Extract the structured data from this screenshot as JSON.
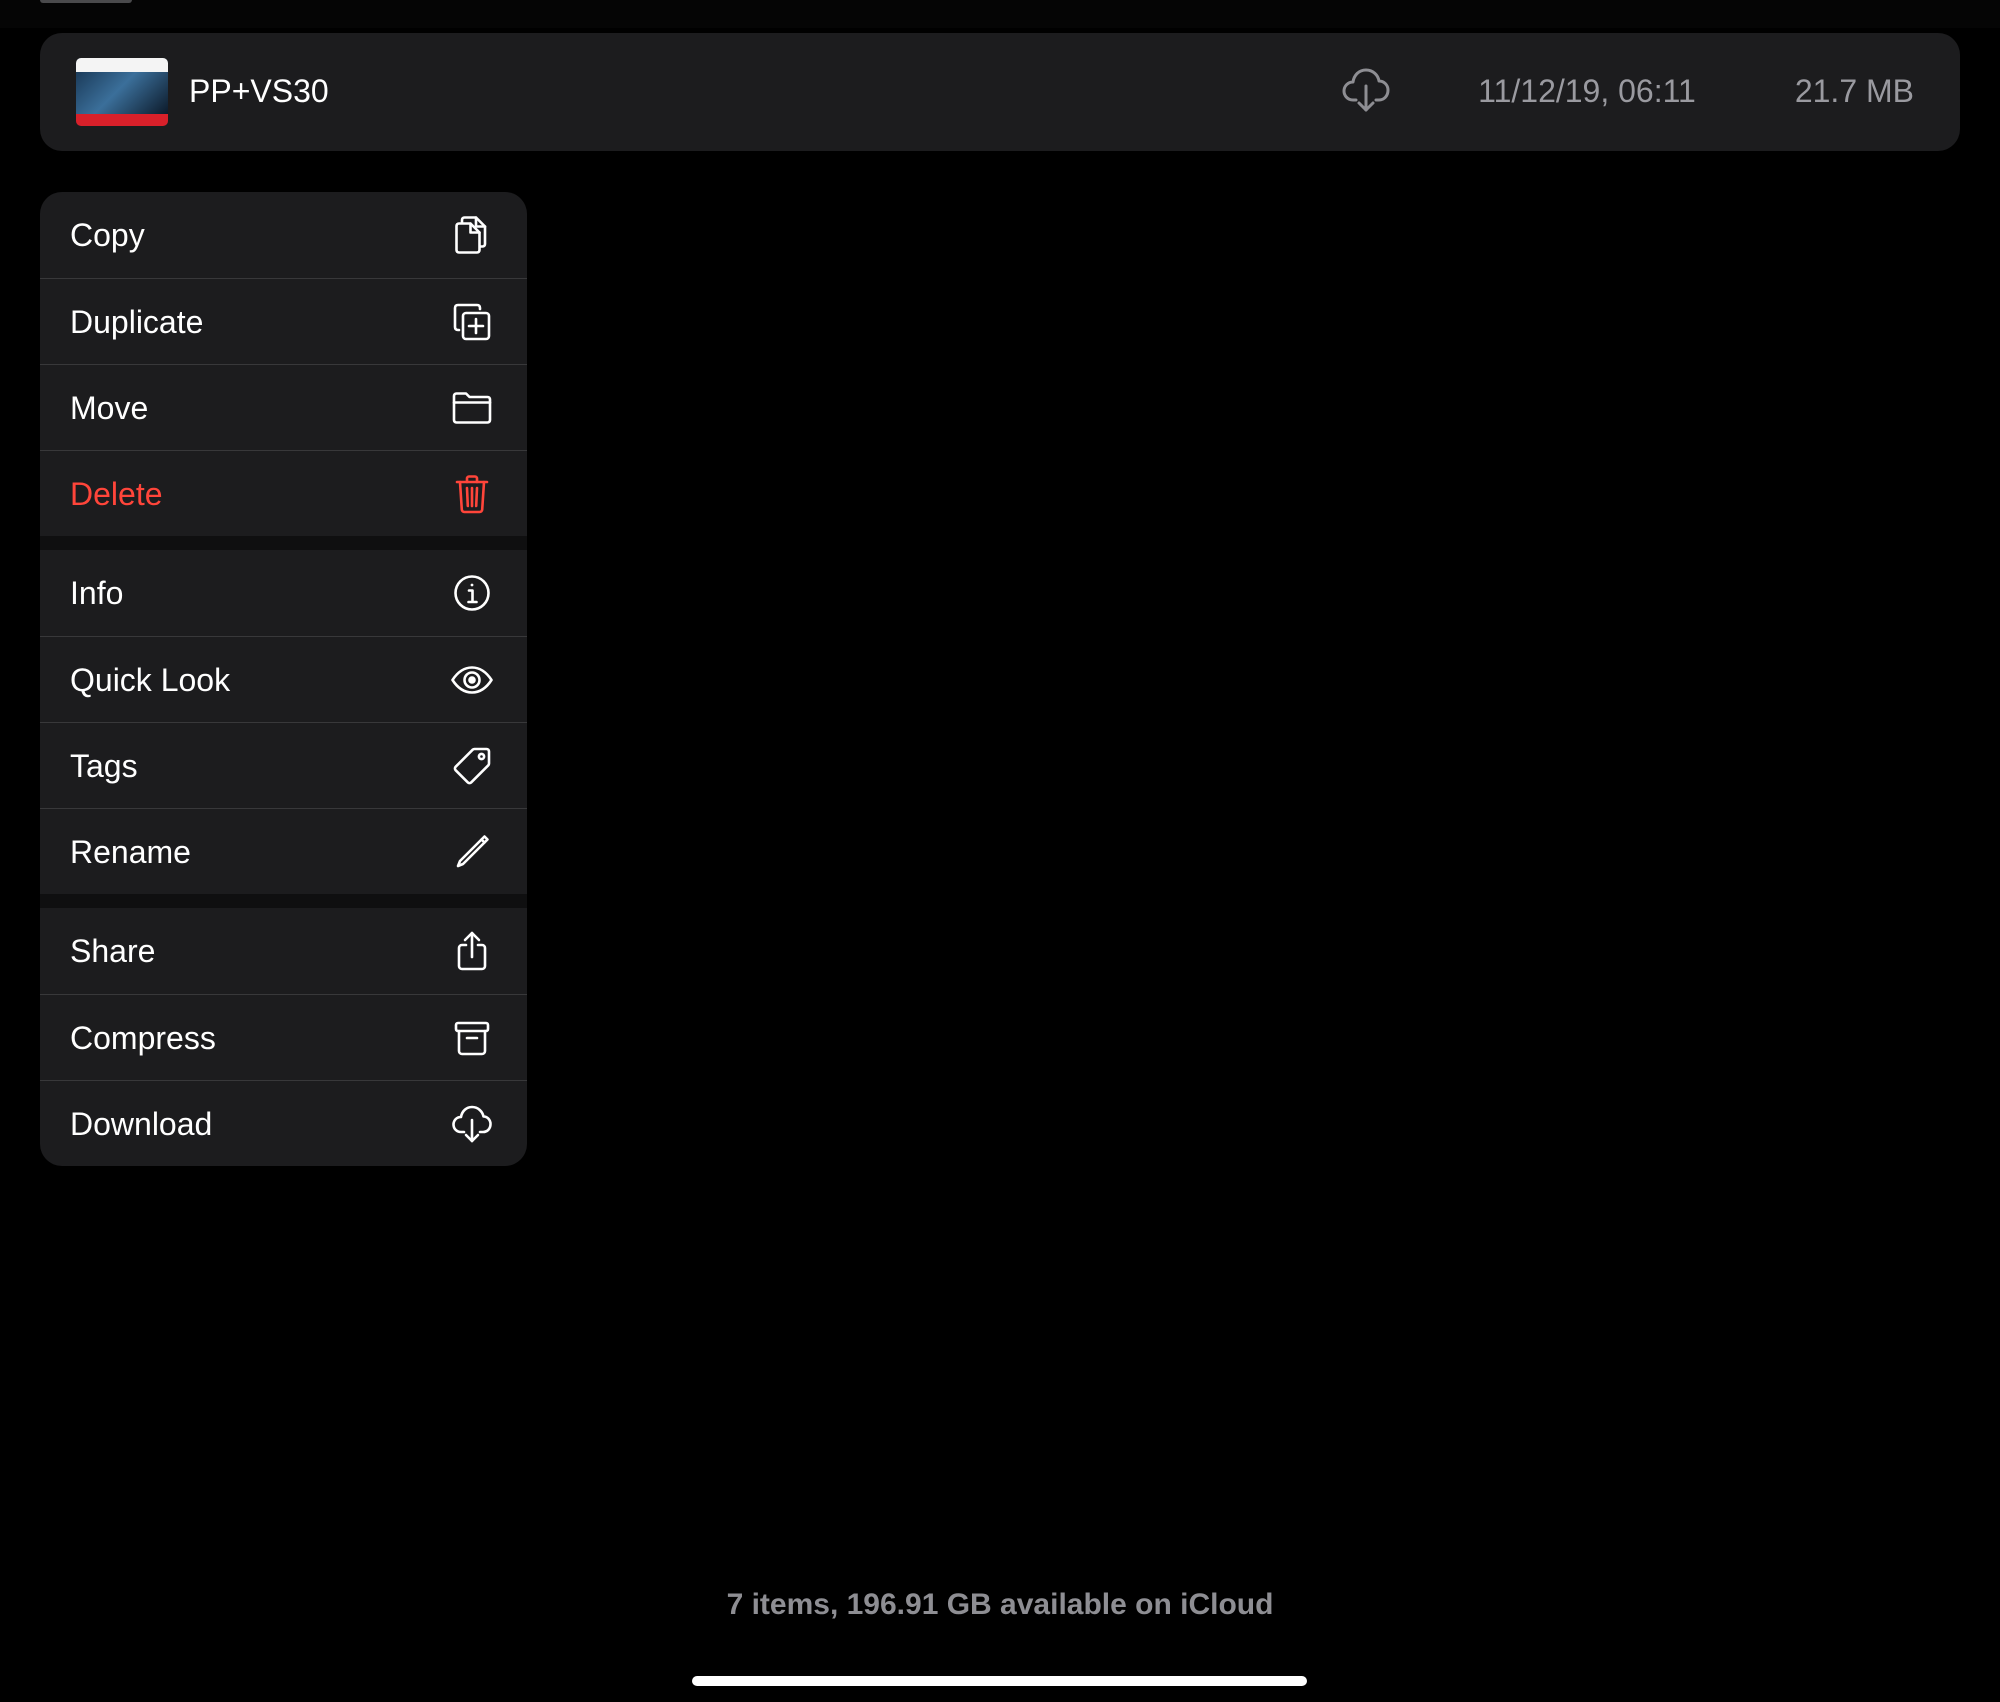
{
  "file": {
    "name": "PP+VS30",
    "date": "11/12/19, 06:11",
    "size": "21.7 MB",
    "status_icon": "cloud-download-icon"
  },
  "menu": {
    "groups": [
      {
        "items": [
          {
            "label": "Copy",
            "icon": "copy-icon"
          },
          {
            "label": "Duplicate",
            "icon": "duplicate-icon"
          },
          {
            "label": "Move",
            "icon": "folder-icon"
          },
          {
            "label": "Delete",
            "icon": "trash-icon",
            "destructive": true
          }
        ]
      },
      {
        "items": [
          {
            "label": "Info",
            "icon": "info-icon"
          },
          {
            "label": "Quick Look",
            "icon": "eye-icon"
          },
          {
            "label": "Tags",
            "icon": "tag-icon"
          },
          {
            "label": "Rename",
            "icon": "pencil-icon"
          }
        ]
      },
      {
        "items": [
          {
            "label": "Share",
            "icon": "share-icon"
          },
          {
            "label": "Compress",
            "icon": "archive-icon"
          },
          {
            "label": "Download",
            "icon": "cloud-download-icon"
          }
        ]
      }
    ]
  },
  "footer": {
    "status": "7 items, 196.91 GB available on iCloud"
  },
  "colors": {
    "background": "#000000",
    "panel": "#1c1c1e",
    "separator": "#38383a",
    "destructive": "#ff453a",
    "secondary_text": "#8e8e93"
  }
}
